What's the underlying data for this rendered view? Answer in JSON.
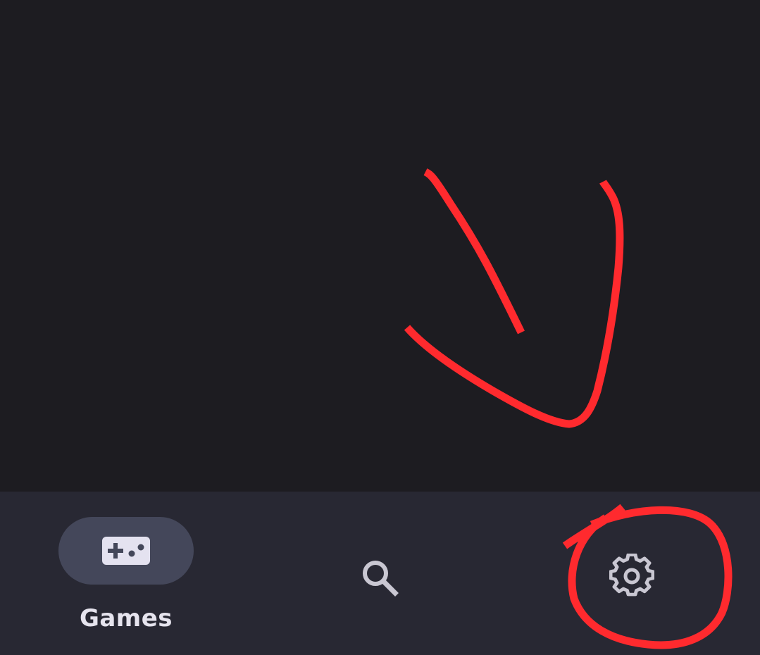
{
  "bottom_nav": {
    "items": [
      {
        "label": "Games",
        "icon": "gamepad-icon",
        "selected": true
      },
      {
        "label": "",
        "icon": "search-icon",
        "selected": false
      },
      {
        "label": "",
        "icon": "gear-icon",
        "selected": false
      }
    ]
  },
  "colors": {
    "background": "#1d1c21",
    "nav_background": "#282833",
    "selected_pill": "#44475a",
    "icon": "#c9c7d2",
    "label": "#e6e4ee",
    "annotation": "#ff2a2e"
  },
  "annotation": {
    "type": "red hand-drawn arrow pointing to circled settings icon"
  }
}
